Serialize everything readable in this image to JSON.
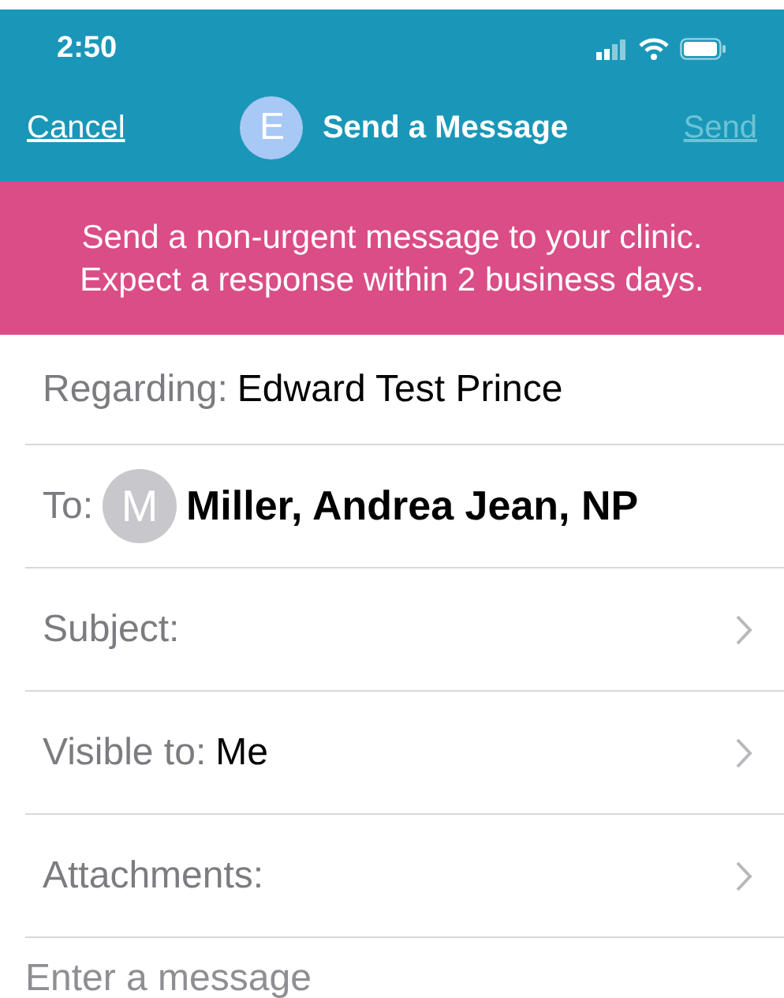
{
  "status_bar": {
    "time": "2:50"
  },
  "nav": {
    "cancel": "Cancel",
    "avatar_letter": "E",
    "title": "Send a Message",
    "send": {
      "label": "Send",
      "disabled": true
    }
  },
  "banner": "Send a non-urgent message to your clinic. Expect a response within 2 business days.",
  "fields": [
    {
      "kind": "text",
      "label": "Regarding:",
      "value": "Edward Test Prince"
    },
    {
      "kind": "recipient",
      "label": "To:",
      "avatar_letter": "M",
      "value": "Miller, Andrea Jean, NP"
    },
    {
      "kind": "chevron",
      "label": "Subject:"
    },
    {
      "kind": "chevron",
      "label": "Visible to:",
      "value": "Me"
    },
    {
      "kind": "chevron",
      "label": "Attachments:"
    }
  ],
  "message": {
    "placeholder": "Enter a message"
  }
}
